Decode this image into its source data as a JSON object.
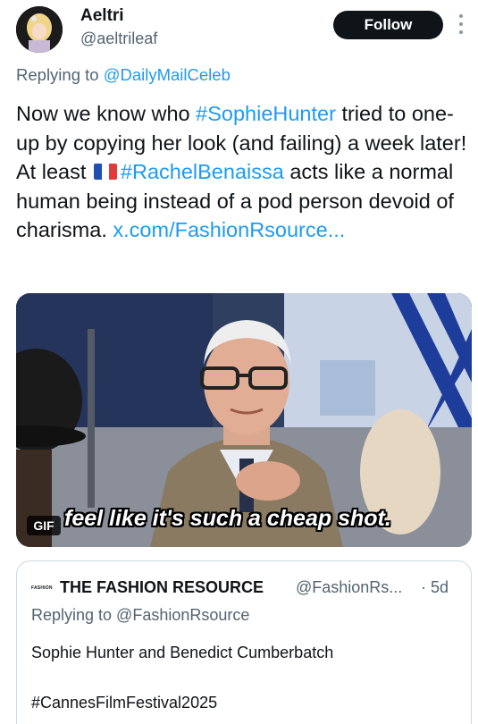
{
  "author": {
    "display_name": "Aeltri",
    "handle": "@aeltrileaf",
    "follow_label": "Follow"
  },
  "reply": {
    "prefix": "Replying to ",
    "mention": "@DailyMailCeleb"
  },
  "tweet": {
    "part1": "Now we know who ",
    "hashtag1": "#SophieHunter",
    "part2": " tried to one-up by copying her look (and failing) a week later! At least ",
    "hashtag2": "#RachelBenaissa",
    "part3": " acts like a normal human being instead of a pod person devoid of charisma.  ",
    "link": "x.com/FashionRsource..."
  },
  "media": {
    "badge": "GIF",
    "caption": "feel like it's such a cheap shot."
  },
  "quote": {
    "logo_text": "FASHION",
    "name": "THE FASHION RESOURCE",
    "handle": "@FashionRs...",
    "time": "· 5d",
    "reply_line": "Replying to @FashionRsource",
    "text": "Sophie Hunter and Benedict Cumberbatch",
    "hashtag": "#CannesFilmFestival2025"
  },
  "colors": {
    "accent": "#1d9bf0",
    "text_primary": "#0f1419",
    "text_secondary": "#536471",
    "follow_bg": "#0f1419",
    "border": "#cfd9de"
  },
  "icons": {
    "more": "more-vertical-icon",
    "flag": "flag-france-icon"
  }
}
